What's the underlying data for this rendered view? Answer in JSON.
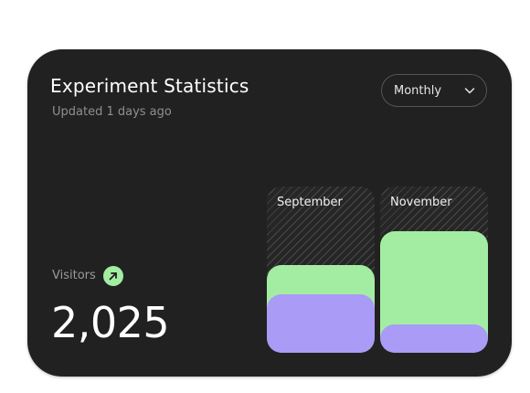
{
  "card": {
    "title": "Experiment Statistics",
    "subtitle": "Updated 1 days ago"
  },
  "dropdown": {
    "selected": "Monthly",
    "icon": "chevron-down-icon"
  },
  "metric": {
    "label": "Visitors",
    "trend_icon": "arrow-up-right-icon",
    "value": "2,025"
  },
  "colors": {
    "card_bg": "#222121",
    "green": "#a3eda3",
    "purple": "#a99bf6"
  },
  "chart_data": {
    "type": "bar",
    "categories": [
      "September",
      "November"
    ],
    "series": [
      {
        "values": [
          0.35,
          0.17
        ]
      },
      {
        "values": [
          0.53,
          0.73
        ]
      }
    ],
    "ylim": [
      0,
      1
    ],
    "stacked": "overlapping"
  }
}
